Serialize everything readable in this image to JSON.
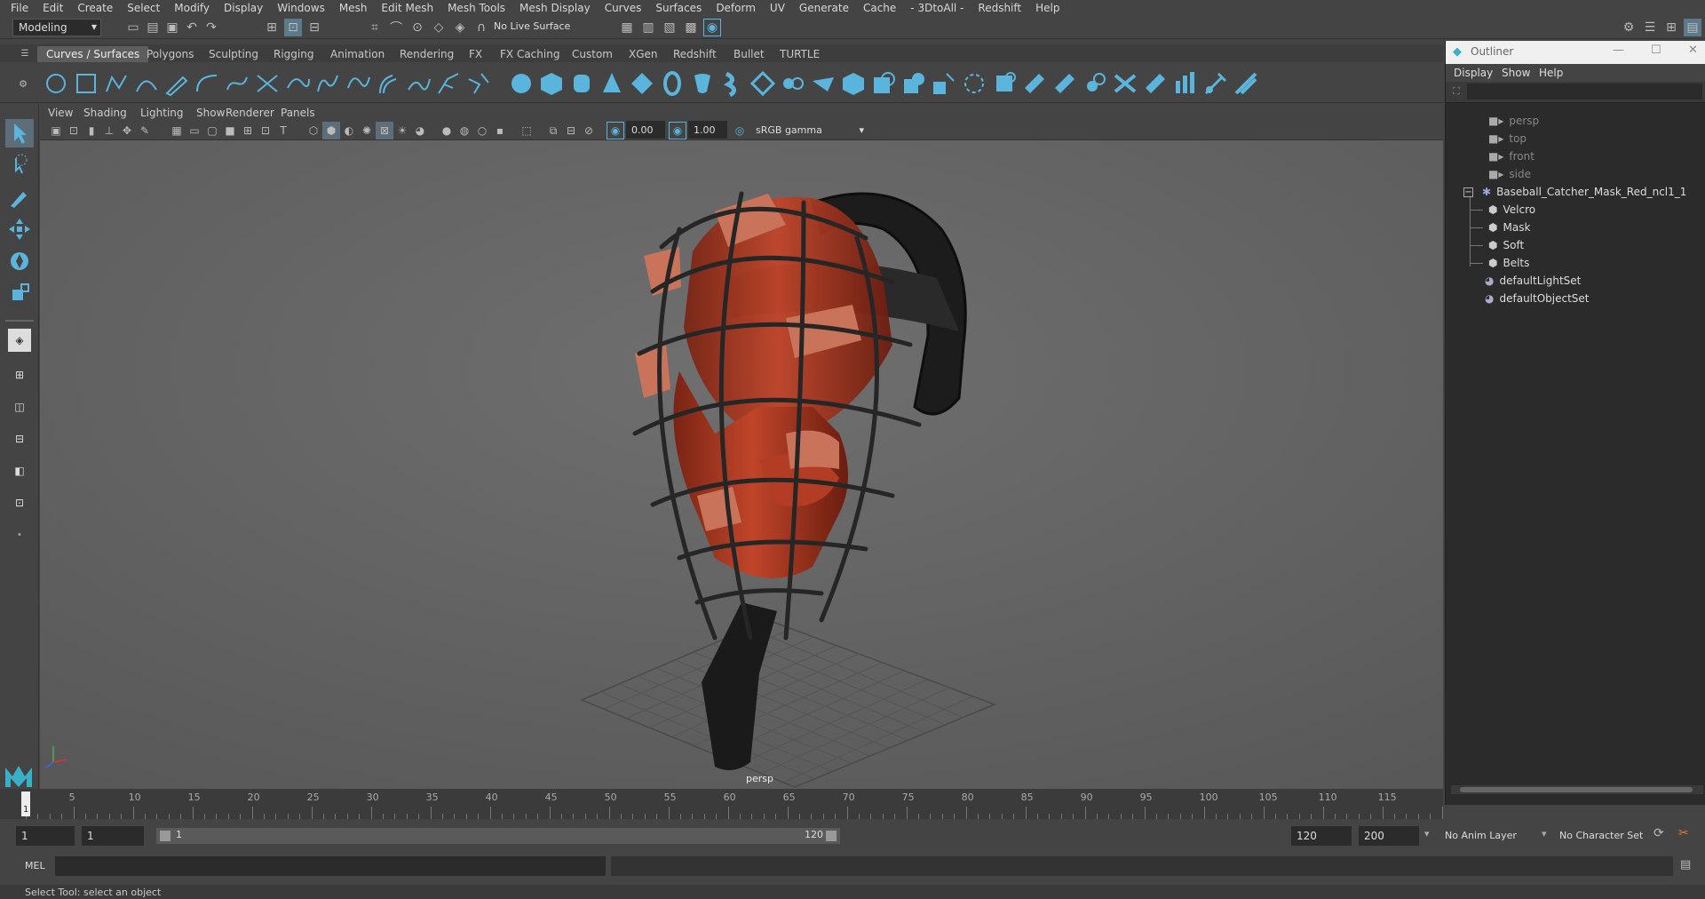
{
  "menubar": [
    "File",
    "Edit",
    "Create",
    "Select",
    "Modify",
    "Display",
    "Windows",
    "Mesh",
    "Edit Mesh",
    "Mesh Tools",
    "Mesh Display",
    "Curves",
    "Surfaces",
    "Deform",
    "UV",
    "Generate",
    "Cache",
    "- 3DtoAll -",
    "Redshift",
    "Help"
  ],
  "status": {
    "mode": "Modeling",
    "live_surface": "No Live Surface"
  },
  "shelf_tabs": [
    "Curves / Surfaces",
    "Polygons",
    "Sculpting",
    "Rigging",
    "Animation",
    "Rendering",
    "FX",
    "FX Caching",
    "Custom",
    "XGen",
    "Redshift",
    "Bullet",
    "TURTLE"
  ],
  "viewport_menu": [
    "View",
    "Shading",
    "Lighting",
    "Show",
    "Renderer",
    "Panels"
  ],
  "viewport_toolbar": {
    "exposure": "0.00",
    "gamma": "1.00",
    "color_space": "sRGB gamma"
  },
  "viewport": {
    "camera_label": "persp"
  },
  "outliner": {
    "title": "Outliner",
    "menu": [
      "Display",
      "Show",
      "Help"
    ],
    "cameras": [
      "persp",
      "top",
      "front",
      "side"
    ],
    "root": "Baseball_Catcher_Mask_Red_ncl1_1",
    "children": [
      "Velcro",
      "Mask",
      "Soft",
      "Belts"
    ],
    "sets": [
      "defaultLightSet",
      "defaultObjectSet"
    ]
  },
  "timeline": {
    "labels": [
      "5",
      "10",
      "15",
      "20",
      "25",
      "30",
      "35",
      "40",
      "45",
      "50",
      "55",
      "60",
      "65",
      "70",
      "75",
      "80",
      "85",
      "90",
      "95",
      "100",
      "105",
      "110",
      "115"
    ],
    "current": "1"
  },
  "range": {
    "start": "1",
    "playback_start": "1",
    "slider_start": "1",
    "slider_end": "120",
    "playback_end": "120",
    "end": "200",
    "anim_layer": "No Anim Layer",
    "character_set": "No Character Set"
  },
  "command": {
    "lang": "MEL"
  },
  "help_line": "Select Tool: select an object",
  "colors": {
    "accent": "#5ab4dc",
    "mask_red": "#b03a22",
    "pad_tan": "#c8735a"
  }
}
